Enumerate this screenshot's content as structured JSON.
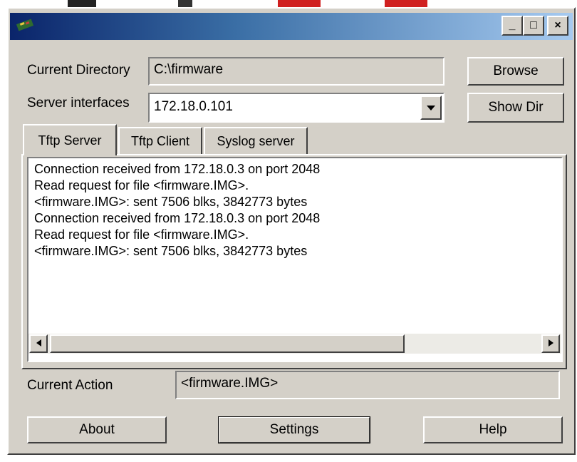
{
  "window": {
    "controls": {
      "minimize": "_",
      "maximize": "□",
      "close": "×"
    }
  },
  "labels": {
    "current_directory": "Current Directory",
    "server_interfaces": "Server interfaces",
    "current_action": "Current Action"
  },
  "fields": {
    "current_directory": "C:\\firmware",
    "server_interface_selected": "172.18.0.101",
    "current_action": "<firmware.IMG>"
  },
  "buttons": {
    "browse": "Browse",
    "show_dir": "Show Dir",
    "about": "About",
    "settings": "Settings",
    "help": "Help"
  },
  "tabs": [
    {
      "label": "Tftp Server",
      "active": true
    },
    {
      "label": "Tftp Client",
      "active": false
    },
    {
      "label": "Syslog server",
      "active": false
    }
  ],
  "log": [
    "Connection received from 172.18.0.3 on port 2048",
    "Read request for file <firmware.IMG>.",
    "<firmware.IMG>: sent 7506 blks, 3842773 bytes",
    "Connection received from 172.18.0.3 on port 2048",
    "Read request for file <firmware.IMG>.",
    "<firmware.IMG>: sent 7506 blks, 3842773 bytes"
  ],
  "icons": {
    "app": "app-icon",
    "dropdown": "chevron-down-icon",
    "scroll_left": "arrow-left-icon",
    "scroll_right": "arrow-right-icon"
  },
  "colors": {
    "titlebar_start": "#0a246a",
    "titlebar_end": "#a6caf0",
    "face": "#d4d0c8"
  }
}
